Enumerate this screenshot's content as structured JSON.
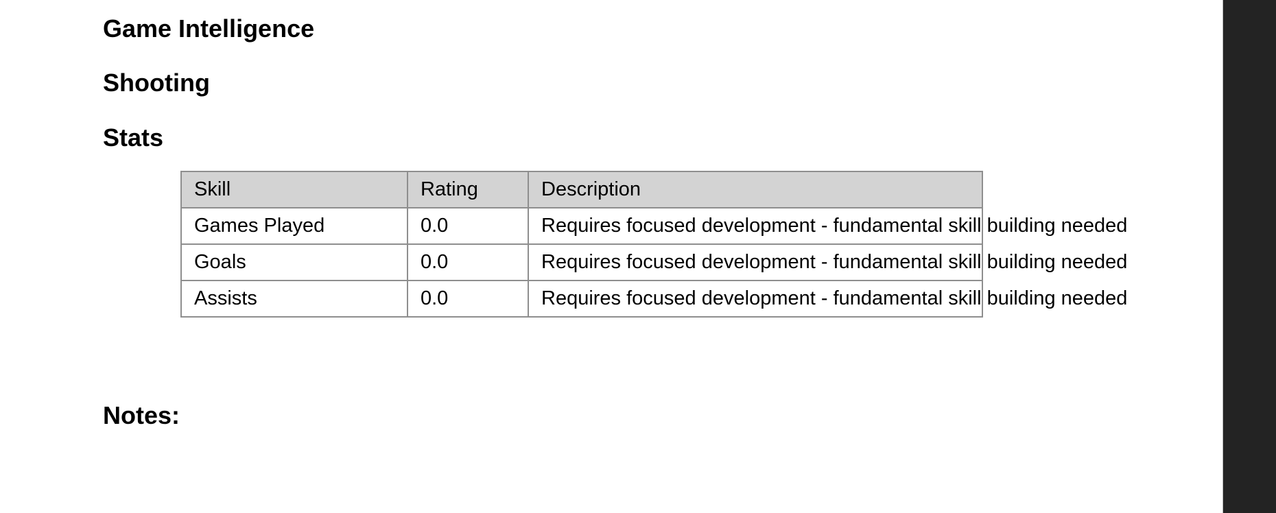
{
  "sections": {
    "game_intelligence": "Game Intelligence",
    "shooting": "Shooting",
    "stats": "Stats",
    "notes": "Notes:"
  },
  "stats_table": {
    "headers": [
      "Skill",
      "Rating",
      "Description"
    ],
    "rows": [
      [
        "Games Played",
        "0.0",
        "Requires focused development - fundamental skill building needed"
      ],
      [
        "Goals",
        "0.0",
        "Requires focused development - fundamental skill building needed"
      ],
      [
        "Assists",
        "0.0",
        "Requires focused development - fundamental skill building needed"
      ]
    ]
  },
  "colors": {
    "header_background": "#d3d3d3",
    "table_border": "#8e8e8e",
    "side_panel": "#232323"
  }
}
